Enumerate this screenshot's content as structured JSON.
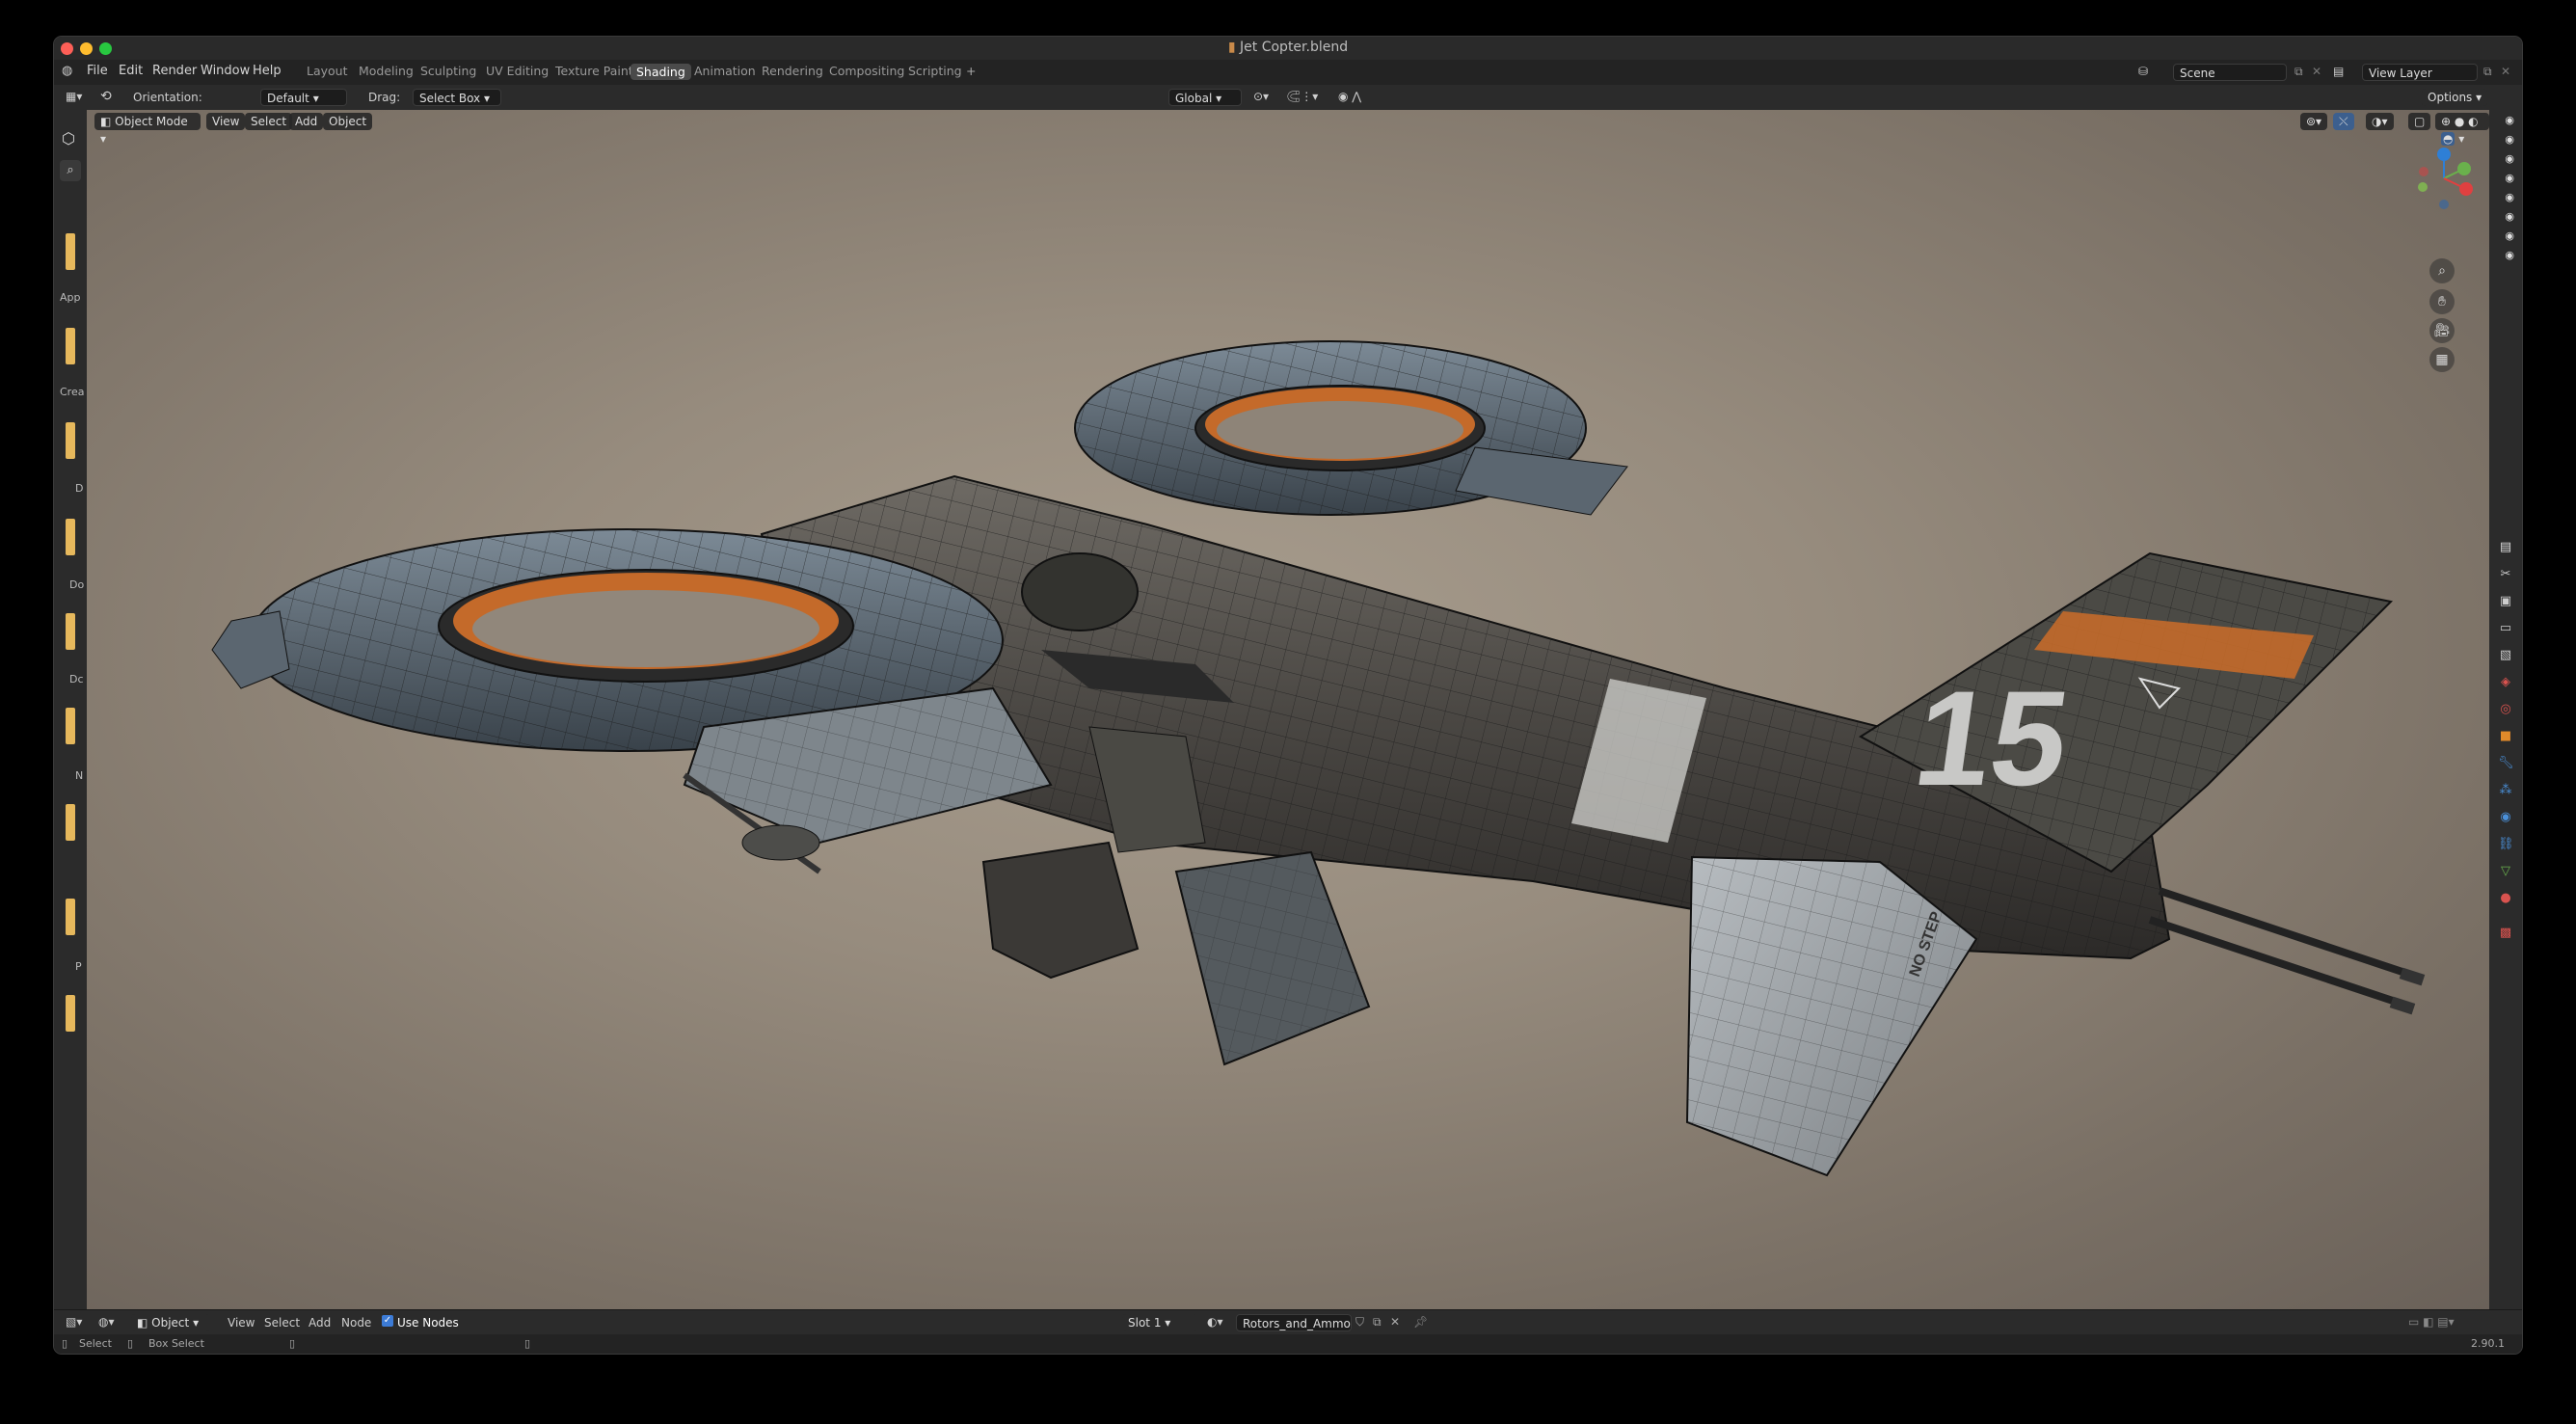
{
  "window": {
    "title": "Jet Copter.blend"
  },
  "menu": [
    "File",
    "Edit",
    "Render",
    "Window",
    "Help"
  ],
  "workspaces": [
    "Layout",
    "Modeling",
    "Sculpting",
    "UV Editing",
    "Texture Paint",
    "Shading",
    "Animation",
    "Rendering",
    "Compositing",
    "Scripting"
  ],
  "active_workspace": "Shading",
  "scene": "Scene",
  "view_layer": "View Layer",
  "toolbar": {
    "orientation_label": "Orientation:",
    "orientation_value": "Default",
    "drag_label": "Drag:",
    "drag_value": "Select Box",
    "transform_orientation": "Global",
    "options": "Options"
  },
  "viewport": {
    "mode": "Object Mode",
    "menus": [
      "View",
      "Select",
      "Add",
      "Object"
    ]
  },
  "left_thumbs": [
    "App",
    "Crea",
    "D",
    "Do",
    "Dc",
    "N",
    "",
    "P",
    ""
  ],
  "shader_editor": {
    "object_type": "Object",
    "menus": [
      "View",
      "Select",
      "Add",
      "Node"
    ],
    "use_nodes_label": "Use Nodes",
    "slot": "Slot 1",
    "material": "Rotors_and_Ammo"
  },
  "status": {
    "select": "Select",
    "box_select": "Box Select",
    "version": "2.90.1"
  },
  "model_text": {
    "tail_number": "15",
    "no_step": "NO STEP"
  },
  "colors": {
    "accent_orange": "#c46a2a",
    "thumb_yellow": "#e6b85c"
  }
}
